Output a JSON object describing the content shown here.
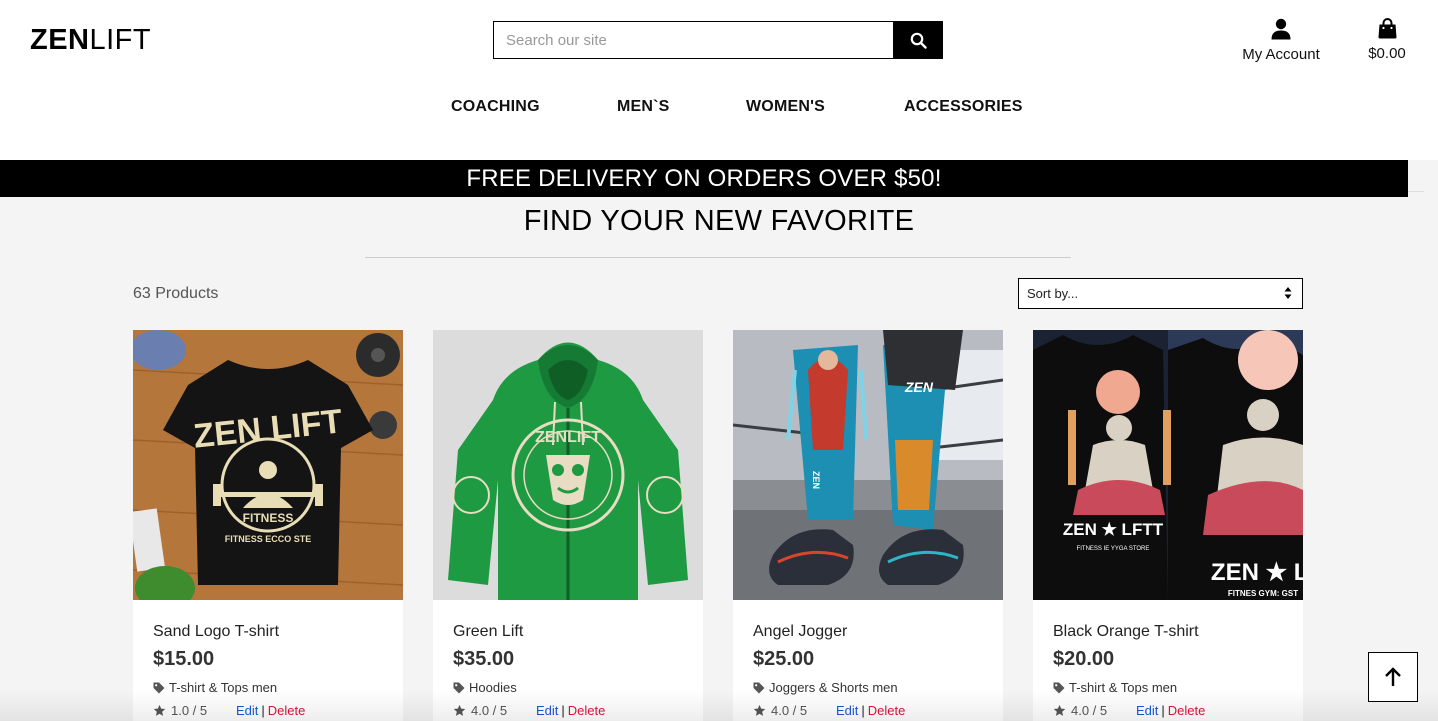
{
  "brand": {
    "name_bold": "ZEN",
    "name_light": "LIFT"
  },
  "search": {
    "placeholder": "Search our site",
    "value": ""
  },
  "header": {
    "account_label": "My Account",
    "cart_total": "$0.00"
  },
  "nav": [
    "COACHING",
    "MEN`S",
    "WOMEN'S",
    "ACCESSORIES"
  ],
  "banner": "FREE DELIVERY ON ORDERS OVER $50!",
  "page_title": "FIND YOUR NEW FAVORITE",
  "product_count": "63 Products",
  "sort": {
    "selected": "Sort by..."
  },
  "products": [
    {
      "name": "Sand Logo T-shirt",
      "price": "$15.00",
      "category": "T-shirt & Tops men",
      "rating": "1.0 / 5",
      "edit": "Edit",
      "sep": "|",
      "delete": "Delete"
    },
    {
      "name": "Green Lift",
      "price": "$35.00",
      "category": "Hoodies",
      "rating": "4.0 / 5",
      "edit": "Edit",
      "sep": "|",
      "delete": "Delete"
    },
    {
      "name": "Angel Jogger",
      "price": "$25.00",
      "category": "Joggers & Shorts men",
      "rating": "4.0 / 5",
      "edit": "Edit",
      "sep": "|",
      "delete": "Delete"
    },
    {
      "name": "Black Orange T-shirt",
      "price": "$20.00",
      "category": "T-shirt & Tops men",
      "rating": "4.0 / 5",
      "edit": "Edit",
      "sep": "|",
      "delete": "Delete"
    }
  ],
  "image_text": {
    "p1": [
      "ZEN LIFT",
      "FITNESS",
      "FITNESS ECCO STE"
    ],
    "p2": [
      "ZENLIFT"
    ],
    "p3": [
      "ZEN",
      "ZEN"
    ],
    "p4": [
      "ZEN ★ LFTT",
      "FITNESS IE YYGA STORE",
      "ZEN ★ LI",
      "FITNES GYM: GST"
    ]
  },
  "colors": {
    "brand": "#000000",
    "edit_link": "#1a56d6",
    "delete_link": "#dc143c",
    "banner_bg": "#000000",
    "page_bg": "#f4f4f4"
  },
  "icons": [
    "search-icon",
    "user-icon",
    "shopping-bag-icon",
    "tag-icon",
    "star-icon",
    "arrow-up-icon",
    "sort-arrows-icon"
  ]
}
